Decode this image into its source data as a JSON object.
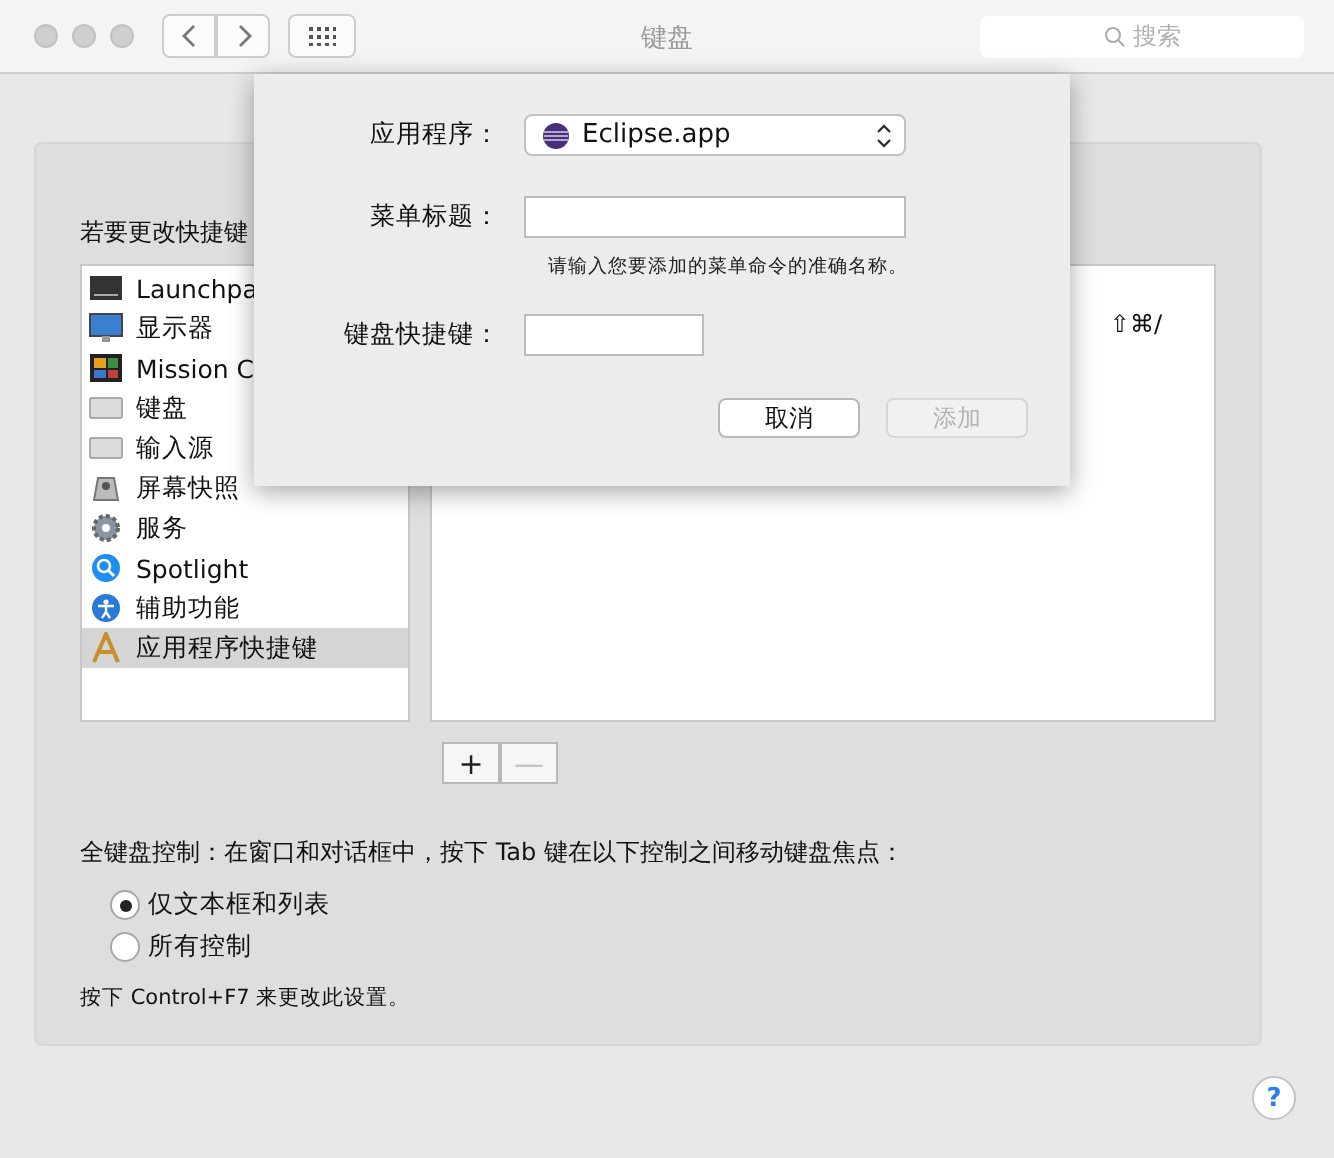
{
  "window": {
    "title": "键盘"
  },
  "search": {
    "placeholder": "搜索"
  },
  "panel": {
    "list_label": "若要更改快捷键",
    "categories": [
      {
        "label": "Launchpa",
        "selected": false
      },
      {
        "label": "显示器",
        "selected": false
      },
      {
        "label": "Mission C",
        "selected": false
      },
      {
        "label": "键盘",
        "selected": false
      },
      {
        "label": "输入源",
        "selected": false
      },
      {
        "label": "屏幕快照",
        "selected": false
      },
      {
        "label": "服务",
        "selected": false
      },
      {
        "label": "Spotlight",
        "selected": false
      },
      {
        "label": "辅助功能",
        "selected": false
      },
      {
        "label": "应用程序快捷键",
        "selected": true
      }
    ],
    "shortcuts": [
      {
        "keys": "⇧⌘/"
      }
    ],
    "add_button": "+",
    "remove_button": "—",
    "full_keyboard_label": "全键盘控制：在窗口和对话框中，按下 Tab 键在以下控制之间移动键盘焦点：",
    "options": [
      {
        "label": "仅文本框和列表",
        "selected": true
      },
      {
        "label": "所有控制",
        "selected": false
      }
    ],
    "note": "按下 Control+F7 来更改此设置。"
  },
  "sheet": {
    "app_label": "应用程序：",
    "app_value": "Eclipse.app",
    "menu_title_label": "菜单标题：",
    "hint": "请输入您要添加的菜单命令的准确名称。",
    "shortcut_label": "键盘快捷键：",
    "buttons": [
      {
        "label": "取消",
        "disabled": false
      },
      {
        "label": "添加",
        "disabled": true
      }
    ]
  },
  "help": "?"
}
